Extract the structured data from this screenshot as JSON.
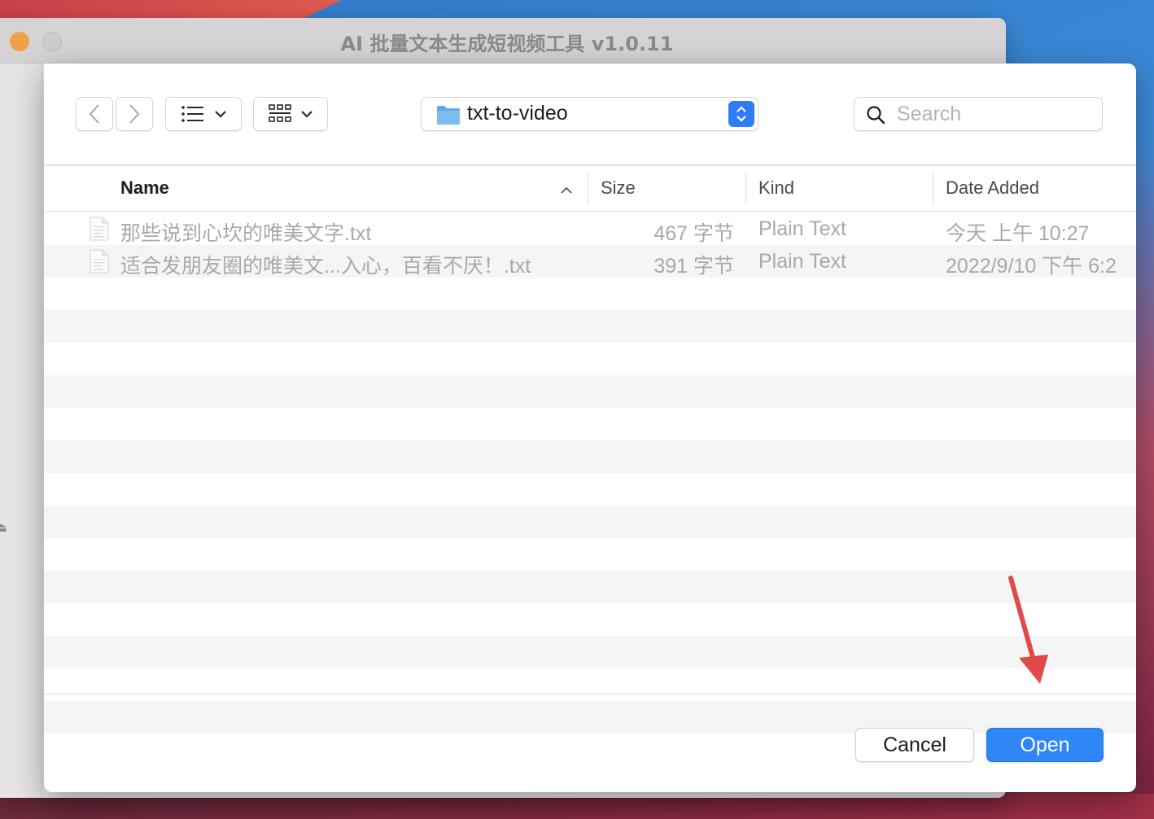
{
  "app": {
    "title": "AI 批量文本生成短视频工具 v1.0.11"
  },
  "toolbar": {
    "back_icon": "chevron-left-icon",
    "forward_icon": "chevron-right-icon",
    "list_view_icon": "list-view-icon",
    "grid_view_icon": "grid-view-icon",
    "path": {
      "folder_icon": "folder-icon",
      "label": "txt-to-video"
    },
    "search": {
      "placeholder": "Search",
      "value": ""
    }
  },
  "table": {
    "columns": {
      "name": "Name",
      "size": "Size",
      "kind": "Kind",
      "date_added": "Date Added"
    },
    "sort": {
      "column": "name",
      "direction": "ascending"
    },
    "rows": [
      {
        "name": "那些说到心坎的唯美文字.txt",
        "size": "467 字节",
        "kind": "Plain Text",
        "date_added": "今天 上午 10:27"
      },
      {
        "name": "适合发朋友圈的唯美文...入心，百看不厌！.txt",
        "size": "391 字节",
        "kind": "Plain Text",
        "date_added": "2022/9/10 下午 6:2"
      }
    ]
  },
  "buttons": {
    "cancel": "Cancel",
    "open": "Open"
  },
  "colors": {
    "accent": "#2e86f7",
    "annotation_arrow": "#e04a4a"
  }
}
